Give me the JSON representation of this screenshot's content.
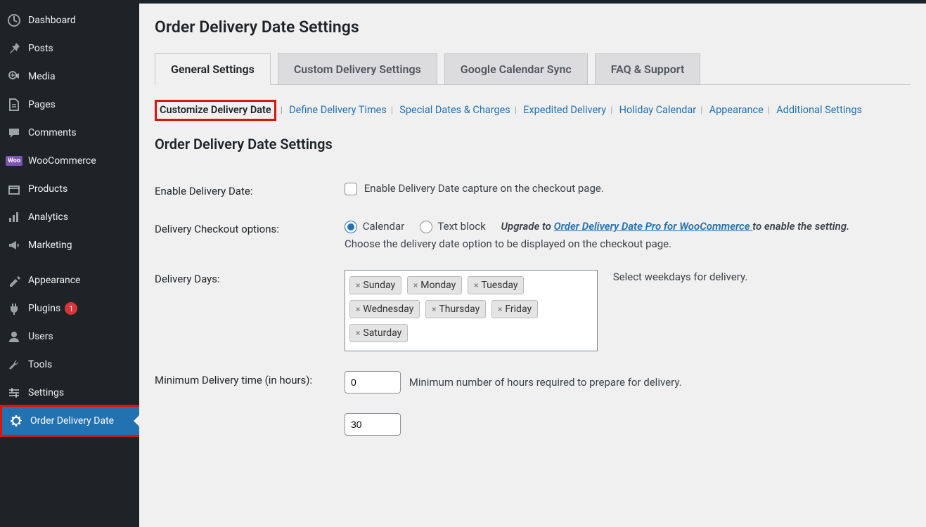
{
  "sidebar": {
    "items": [
      {
        "icon": "dashboard-icon",
        "label": "Dashboard"
      },
      {
        "icon": "pin-icon",
        "label": "Posts"
      },
      {
        "icon": "media-icon",
        "label": "Media"
      },
      {
        "icon": "page-icon",
        "label": "Pages"
      },
      {
        "icon": "comment-icon",
        "label": "Comments"
      },
      {
        "icon": "woo-icon",
        "label": "WooCommerce"
      },
      {
        "icon": "products-icon",
        "label": "Products"
      },
      {
        "icon": "analytics-icon",
        "label": "Analytics"
      },
      {
        "icon": "marketing-icon",
        "label": "Marketing"
      },
      {
        "icon": "appearance-icon",
        "label": "Appearance"
      },
      {
        "icon": "plugins-icon",
        "label": "Plugins",
        "badge": "1"
      },
      {
        "icon": "users-icon",
        "label": "Users"
      },
      {
        "icon": "tools-icon",
        "label": "Tools"
      },
      {
        "icon": "settings-icon",
        "label": "Settings"
      },
      {
        "icon": "gear-icon",
        "label": "Order Delivery Date",
        "active": true
      }
    ]
  },
  "page": {
    "title": "Order Delivery Date Settings"
  },
  "tabs": [
    {
      "label": "General Settings",
      "active": true
    },
    {
      "label": "Custom Delivery Settings"
    },
    {
      "label": "Google Calendar Sync"
    },
    {
      "label": "FAQ & Support"
    }
  ],
  "subnav": [
    {
      "label": "Customize Delivery Date",
      "current": true
    },
    {
      "label": "Define Delivery Times"
    },
    {
      "label": "Special Dates & Charges"
    },
    {
      "label": "Expedited Delivery"
    },
    {
      "label": "Holiday Calendar"
    },
    {
      "label": "Appearance"
    },
    {
      "label": "Additional Settings"
    }
  ],
  "section": {
    "title": "Order Delivery Date Settings"
  },
  "fields": {
    "enable": {
      "label": "Enable Delivery Date:",
      "checkbox_label": "Enable Delivery Date capture on the checkout page."
    },
    "checkout": {
      "label": "Delivery Checkout options:",
      "opt_calendar": "Calendar",
      "opt_textblock": "Text block",
      "upgrade_prefix": "Upgrade to ",
      "upgrade_link": "Order Delivery Date Pro for WooCommerce ",
      "upgrade_suffix": "to enable the setting.",
      "help": "Choose the delivery date option to be displayed on the checkout page."
    },
    "days": {
      "label": "Delivery Days:",
      "chips": [
        "Sunday",
        "Monday",
        "Tuesday",
        "Wednesday",
        "Thursday",
        "Friday",
        "Saturday"
      ],
      "help": "Select weekdays for delivery."
    },
    "mintime": {
      "label": "Minimum Delivery time (in hours):",
      "value": "0",
      "help": "Minimum number of hours required to prepare for delivery."
    },
    "numdates": {
      "value": "30"
    }
  }
}
